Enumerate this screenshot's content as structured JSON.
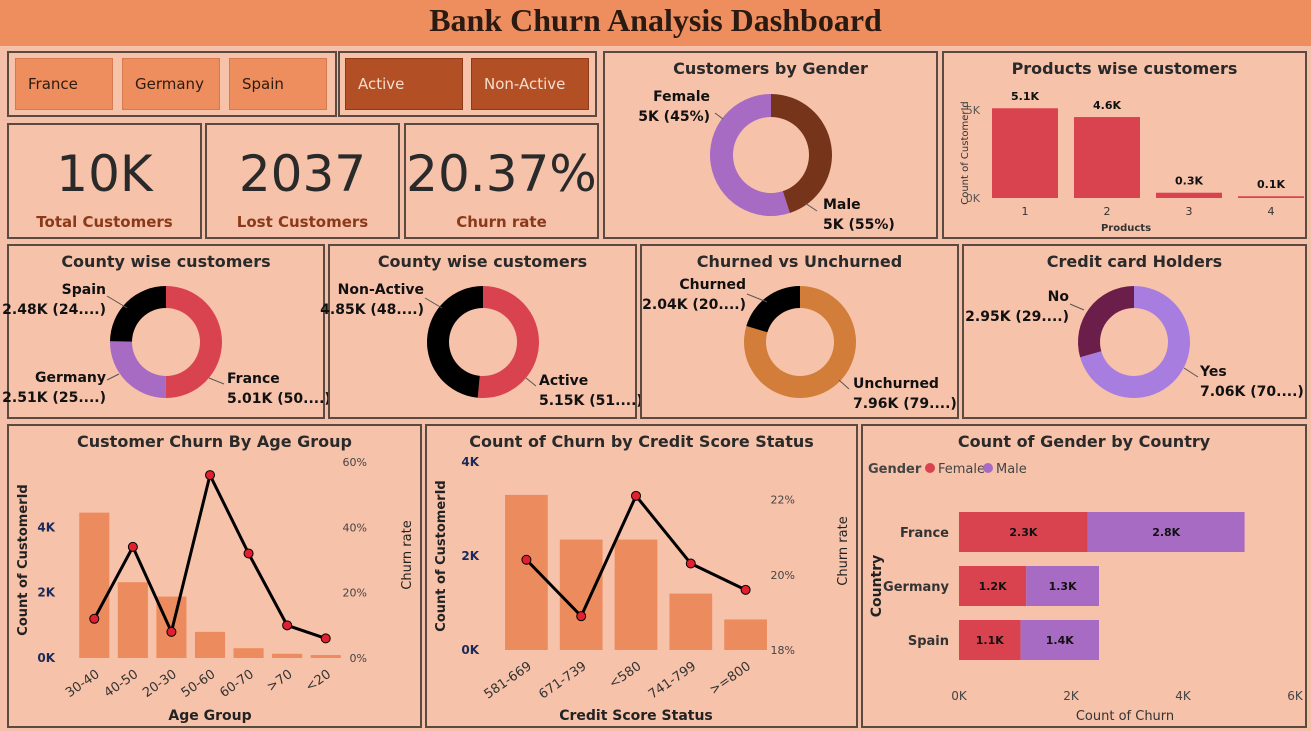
{
  "title": "Bank Churn Analysis Dashboard",
  "slicers": {
    "countries": [
      "France",
      "Germany",
      "Spain"
    ],
    "activity": [
      "Active",
      "Non-Active"
    ]
  },
  "kpis": [
    {
      "value": "10K",
      "label": "Total Customers"
    },
    {
      "value": "2037",
      "label": "Lost Customers"
    },
    {
      "value": "20.37%",
      "label": "Churn rate"
    }
  ],
  "colors": {
    "red": "#d9434f",
    "purple": "#a86bc4",
    "dark_brown": "#76341b",
    "black": "#000000",
    "orange_bar": "#ec8b5e",
    "churn_orange": "#d27e3a",
    "lilac": "#a77de0",
    "plum": "#6b1e4a"
  },
  "chart_data": [
    {
      "id": "gender",
      "type": "pie",
      "title": "Customers by Gender",
      "slices": [
        {
          "label": "Female",
          "value": 45,
          "text": "5K (45%)",
          "color": "#76341b"
        },
        {
          "label": "Male",
          "value": 55,
          "text": "5K (55%)",
          "color": "#a86bc4"
        }
      ]
    },
    {
      "id": "products",
      "type": "bar",
      "title": "Products wise customers",
      "categories": [
        "1",
        "2",
        "3",
        "4"
      ],
      "values": [
        5.1,
        4.6,
        0.3,
        0.1
      ],
      "data_labels": [
        "5.1K",
        "4.6K",
        "0.3K",
        "0.1K"
      ],
      "xlabel": "Products",
      "ylabel": "Count of CustomerId",
      "yticks": [
        "0K",
        "5K"
      ],
      "ylim": [
        0,
        6
      ]
    },
    {
      "id": "country",
      "type": "pie",
      "title": "County wise customers",
      "slices": [
        {
          "label": "France",
          "value": 50.1,
          "text": "5.01K (50....)",
          "color": "#d9434f"
        },
        {
          "label": "Germany",
          "value": 25.1,
          "text": "2.51K (25....)",
          "color": "#a86bc4"
        },
        {
          "label": "Spain",
          "value": 24.8,
          "text": "2.48K (24....)",
          "color": "#000000"
        }
      ]
    },
    {
      "id": "activity",
      "type": "pie",
      "title": "County wise customers",
      "slices": [
        {
          "label": "Active",
          "value": 51.5,
          "text": "5.15K (51....)",
          "color": "#d9434f"
        },
        {
          "label": "Non-Active",
          "value": 48.5,
          "text": "4.85K (48....)",
          "color": "#000000"
        }
      ]
    },
    {
      "id": "churned",
      "type": "pie",
      "title": "Churned vs Unchurned",
      "slices": [
        {
          "label": "Unchurned",
          "value": 79.6,
          "text": "7.96K (79....)",
          "color": "#d27e3a"
        },
        {
          "label": "Churned",
          "value": 20.4,
          "text": "2.04K (20....)",
          "color": "#000000"
        }
      ]
    },
    {
      "id": "creditcard",
      "type": "pie",
      "title": "Credit card Holders",
      "slices": [
        {
          "label": "Yes",
          "value": 70.6,
          "text": "7.06K (70....)",
          "color": "#a77de0"
        },
        {
          "label": "No",
          "value": 29.4,
          "text": "2.95K (29....)",
          "color": "#6b1e4a"
        }
      ]
    },
    {
      "id": "age",
      "type": "bar",
      "title": "Customer Churn By Age Group",
      "categories": [
        "30-40",
        "40-50",
        "20-30",
        "50-60",
        "60-70",
        ">70",
        "<20"
      ],
      "bars": [
        4.45,
        2.32,
        1.88,
        0.8,
        0.3,
        0.13,
        0.09
      ],
      "line": [
        12,
        34,
        8,
        56,
        32,
        10,
        6
      ],
      "xlabel": "Age Group",
      "ylabel": "Count of CustomerId",
      "y2label": "Churn rate",
      "yticks": [
        "0K",
        "2K",
        "4K"
      ],
      "y2ticks": [
        "0%",
        "20%",
        "40%",
        "60%"
      ],
      "ylim": [
        0,
        6
      ],
      "y2lim": [
        0,
        60
      ]
    },
    {
      "id": "credit",
      "type": "bar",
      "title": "Count of Churn by Credit Score Status",
      "categories": [
        "581-669",
        "671-739",
        "<580",
        "741-799",
        ">=800"
      ],
      "bars": [
        3.3,
        2.35,
        2.35,
        1.2,
        0.65
      ],
      "line": [
        20.4,
        18.9,
        22.1,
        20.3,
        19.6
      ],
      "xlabel": "Credit Score Status",
      "ylabel": "Count of CustomerId",
      "y2label": "Churn rate",
      "yticks": [
        "0K",
        "2K",
        "4K"
      ],
      "y2ticks": [
        "18%",
        "20%",
        "22%"
      ],
      "ylim": [
        0,
        4
      ],
      "y2lim": [
        18,
        23
      ]
    },
    {
      "id": "gender_country",
      "type": "bar",
      "orientation": "horizontal",
      "stacked": true,
      "title": "Count of Gender by Country",
      "legend_title": "Gender",
      "categories": [
        "France",
        "Germany",
        "Spain"
      ],
      "series": [
        {
          "name": "Female",
          "values": [
            2.3,
            1.2,
            1.1
          ],
          "labels": [
            "2.3K",
            "1.2K",
            "1.1K"
          ],
          "color": "#d9434f"
        },
        {
          "name": "Male",
          "values": [
            2.8,
            1.3,
            1.4
          ],
          "labels": [
            "2.8K",
            "1.3K",
            "1.4K"
          ],
          "color": "#a86bc4"
        }
      ],
      "xlabel": "Count of Churn",
      "ylabel": "Country",
      "xticks": [
        "0K",
        "2K",
        "4K",
        "6K"
      ],
      "xlim": [
        0,
        6
      ]
    }
  ]
}
